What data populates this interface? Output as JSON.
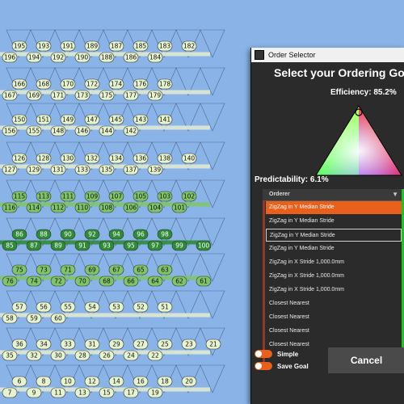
{
  "background_color": "#8ab4e8",
  "node_color": "#e6f3d0",
  "grid_rows": [
    {
      "labels": [
        "195",
        "193",
        "191",
        "189",
        "187",
        "185",
        "183",
        "182"
      ],
      "left_labels": [
        "196",
        "194",
        "192",
        "190",
        "188",
        "186",
        "184"
      ],
      "shade": "light"
    },
    {
      "labels": [
        "166",
        "168",
        "170",
        "172",
        "174",
        "176",
        "178"
      ],
      "left_labels": [
        "167",
        "169",
        "171",
        "173",
        "175",
        "177",
        "179"
      ],
      "shade": "light"
    },
    {
      "labels": [
        "150",
        "151",
        "149",
        "147",
        "145",
        "143",
        "141"
      ],
      "left_labels": [
        "156",
        "155",
        "148",
        "146",
        "144",
        "142"
      ],
      "shade": "light"
    },
    {
      "labels": [
        "126",
        "128",
        "130",
        "132",
        "134",
        "136",
        "138",
        "140"
      ],
      "left_labels": [
        "127",
        "129",
        "131",
        "133",
        "135",
        "137",
        "139"
      ],
      "shade": "light"
    },
    {
      "labels": [
        "115",
        "113",
        "111",
        "109",
        "107",
        "105",
        "103",
        "102"
      ],
      "left_labels": [
        "116",
        "114",
        "112",
        "110",
        "108",
        "106",
        "104",
        "101"
      ],
      "shade": "mid"
    },
    {
      "labels": [
        "86",
        "88",
        "90",
        "92",
        "94",
        "96",
        "98"
      ],
      "left_labels": [
        "85",
        "87",
        "89",
        "91",
        "93",
        "95",
        "97",
        "99",
        "100"
      ],
      "shade": "dark"
    },
    {
      "labels": [
        "75",
        "73",
        "71",
        "69",
        "67",
        "65",
        "63"
      ],
      "left_labels": [
        "76",
        "74",
        "72",
        "70",
        "68",
        "66",
        "64",
        "62",
        "61"
      ],
      "shade": "mid"
    },
    {
      "labels": [
        "57",
        "56",
        "55",
        "54",
        "53",
        "52",
        "51"
      ],
      "left_labels": [
        "58",
        "59",
        "60"
      ],
      "shade": "light"
    },
    {
      "labels": [
        "36",
        "34",
        "33",
        "31",
        "29",
        "27",
        "25",
        "23",
        "21"
      ],
      "left_labels": [
        "35",
        "32",
        "30",
        "28",
        "26",
        "24",
        "22"
      ],
      "shade": "light"
    },
    {
      "labels": [
        "6",
        "8",
        "10",
        "12",
        "14",
        "16",
        "18",
        "20"
      ],
      "left_labels": [
        "7",
        "9",
        "11",
        "13",
        "15",
        "17",
        "19"
      ],
      "shade": "light"
    }
  ],
  "dialog": {
    "title": "Order Selector",
    "heading": "Select your Ordering Goal",
    "efficiency": "Efficiency: 85.2%",
    "predictability": "Predictability: 6.1%",
    "list_header": "Orderer",
    "rows": [
      "ZigZag in Y Median Stride",
      "ZigZag in Y Median Stride",
      "ZigZag in Y Median Stride",
      "ZigZag in Y Median Stride",
      "ZigZag in X Stride 1,000.0mm",
      "ZigZag in X Stride 1,000.0mm",
      "ZigZag in X Stride 1,000.0mm",
      "Closest Nearest",
      "Closest Nearest",
      "Closest Nearest",
      "Closest Nearest"
    ],
    "selected_index": 0,
    "focused_index": 2,
    "toggle_simple": "Simple",
    "toggle_save": "Save Goal",
    "cancel_label": "Cancel",
    "accent_color": "#e8601c",
    "green_color": "#22c022"
  }
}
